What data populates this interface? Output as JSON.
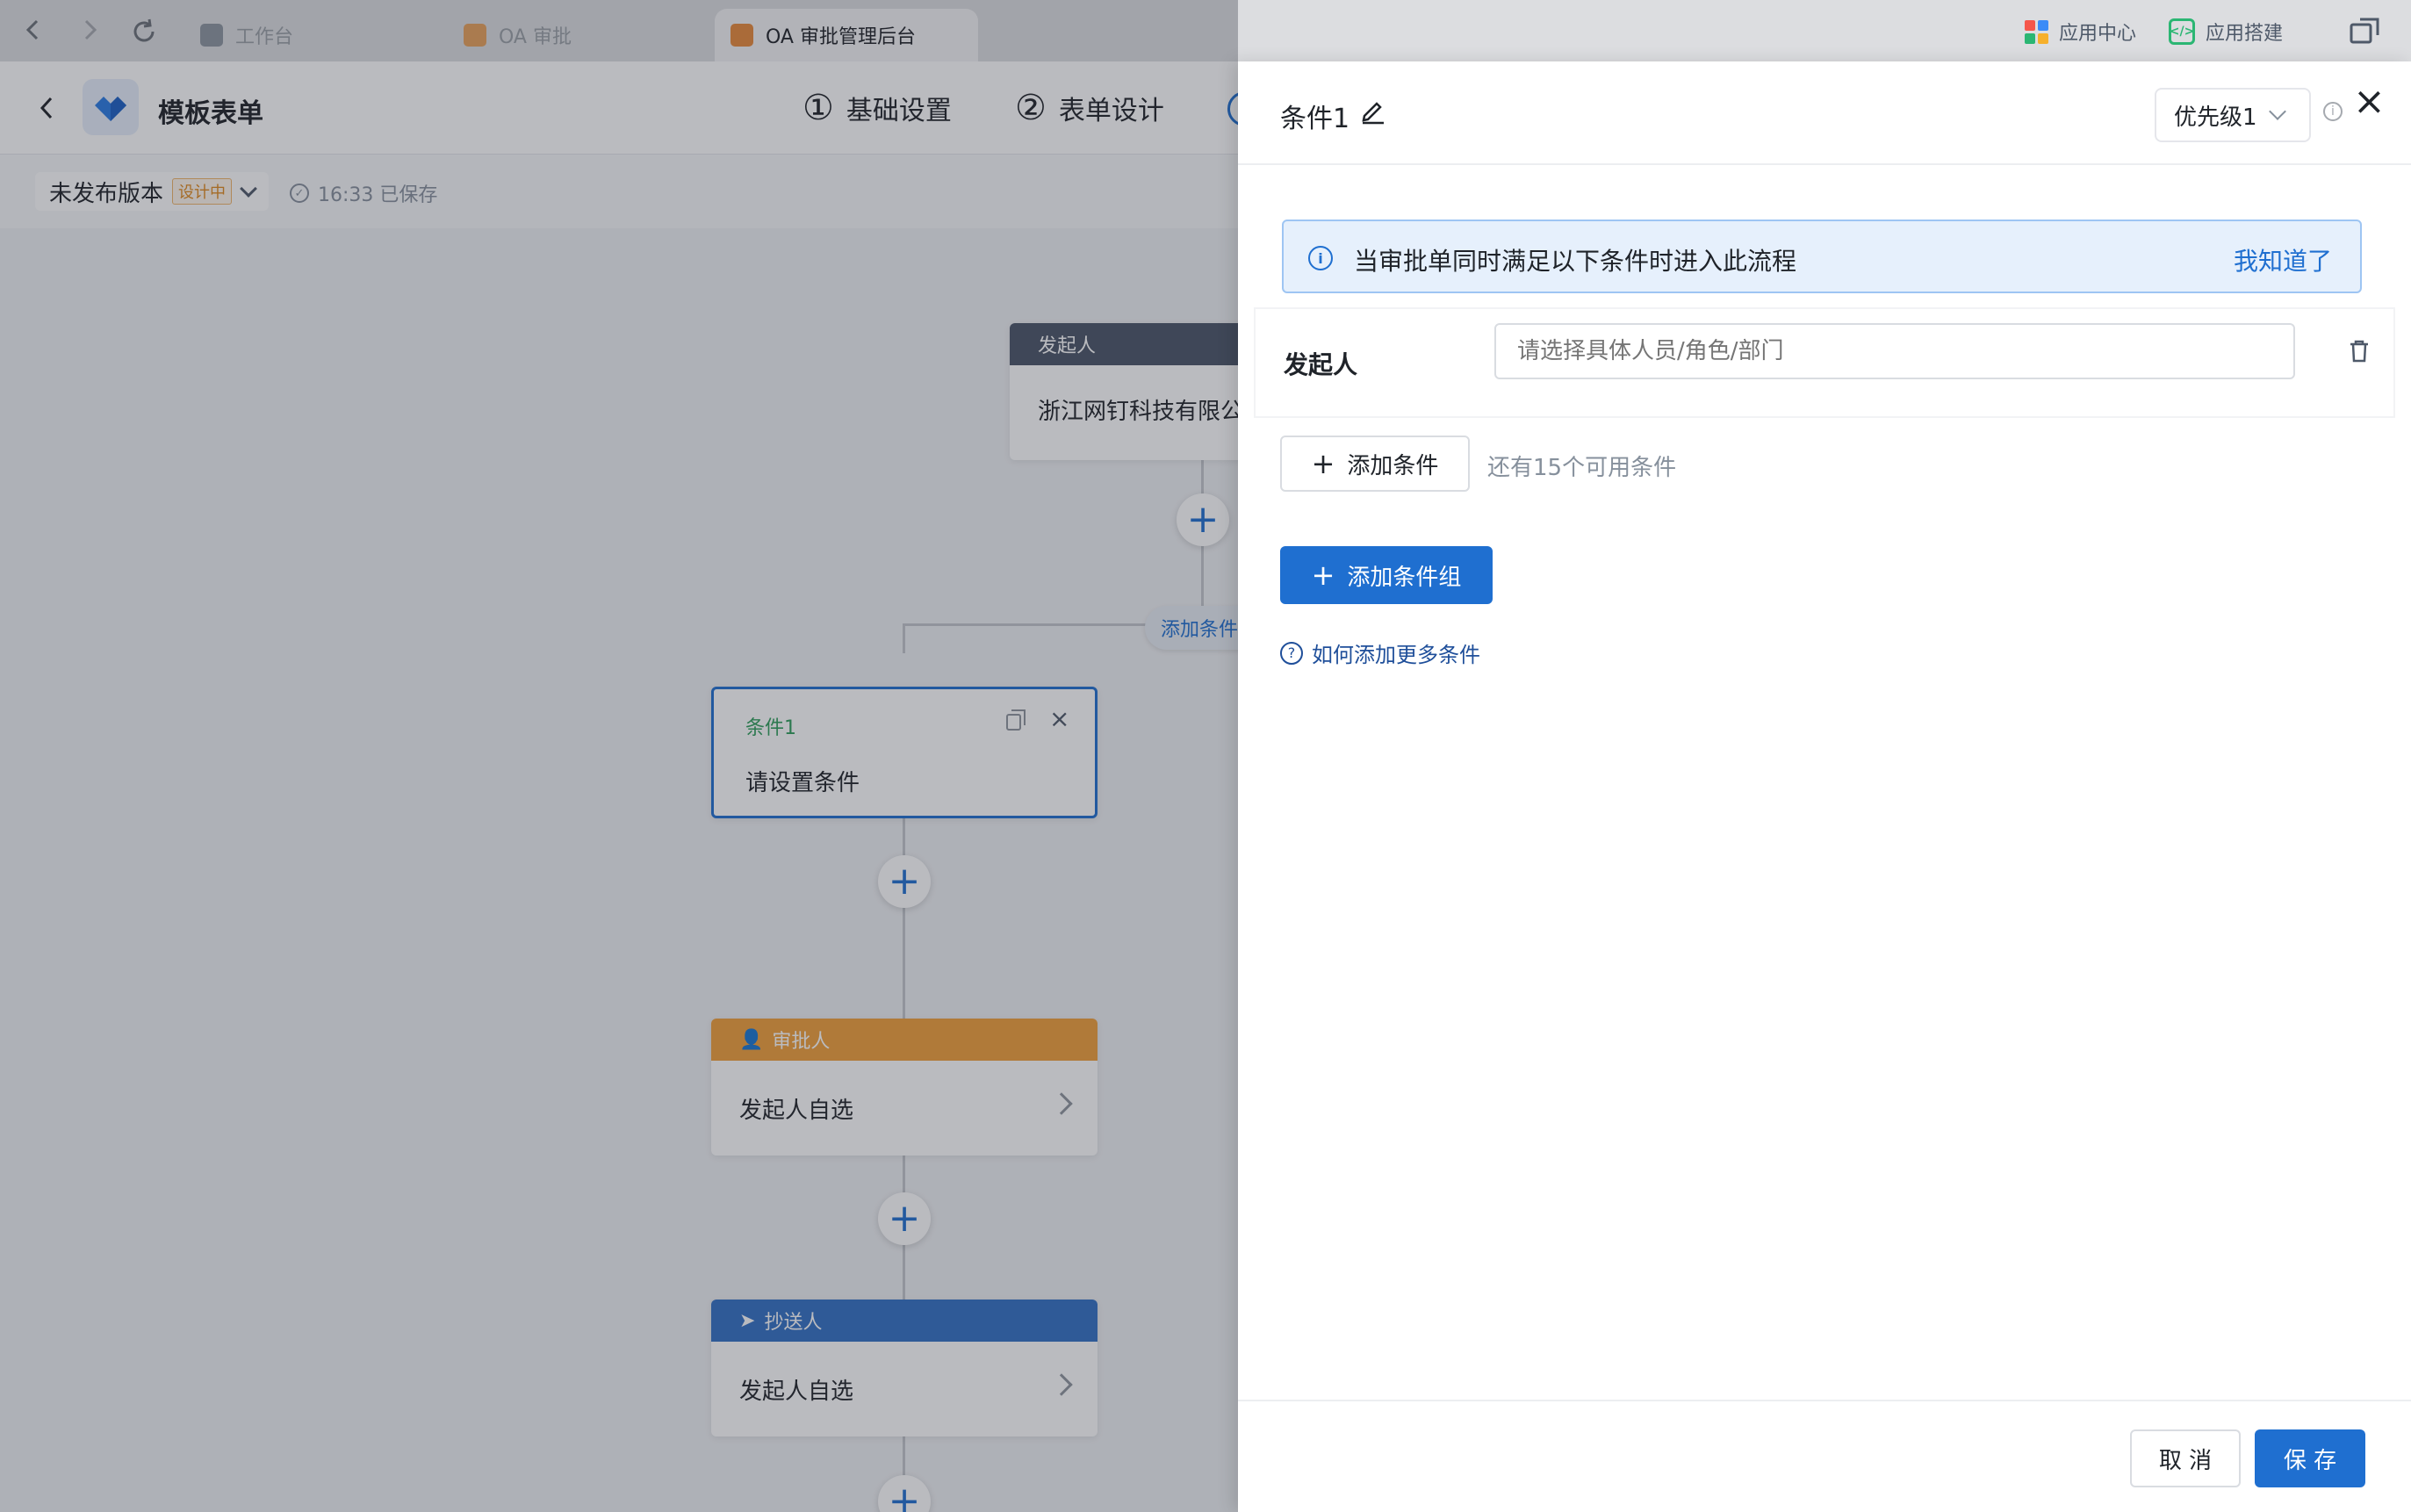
{
  "browser": {
    "tabs": [
      {
        "title": "工作台"
      },
      {
        "title": "OA 审批"
      },
      {
        "title": "OA 审批管理后台"
      }
    ],
    "app_center": "应用中心",
    "app_builder": "应用搭建"
  },
  "header": {
    "title": "模板表单",
    "steps": [
      {
        "num": "①",
        "label": "基础设置"
      },
      {
        "num": "②",
        "label": "表单设计"
      }
    ]
  },
  "subbar": {
    "version": "未发布版本",
    "badge": "设计中",
    "saved": "16:33 已保存"
  },
  "flow": {
    "initiator_head": "发起人",
    "initiator_body": "浙江网钉科技有限公",
    "add_condition": "添加条件",
    "condition_title": "条件1",
    "condition_body": "请设置条件",
    "approver_head": "审批人",
    "approver_body": "发起人自选",
    "cc_head": "抄送人",
    "cc_body": "发起人自选"
  },
  "drawer": {
    "title": "条件1",
    "priority": "优先级1",
    "notice": "当审批单同时满足以下条件时进入此流程",
    "notice_ack": "我知道了",
    "field_label": "发起人",
    "field_placeholder": "请选择具体人员/角色/部门",
    "add_condition": "添加条件",
    "remaining": "还有15个可用条件",
    "add_group": "添加条件组",
    "help": "如何添加更多条件",
    "cancel": "取 消",
    "save": "保 存"
  },
  "colors": {
    "primary": "#1f6fd0",
    "approver": "#f0a03a",
    "cc": "#3370c4",
    "initiator": "#4a5568",
    "condition": "#2e9e5b"
  }
}
